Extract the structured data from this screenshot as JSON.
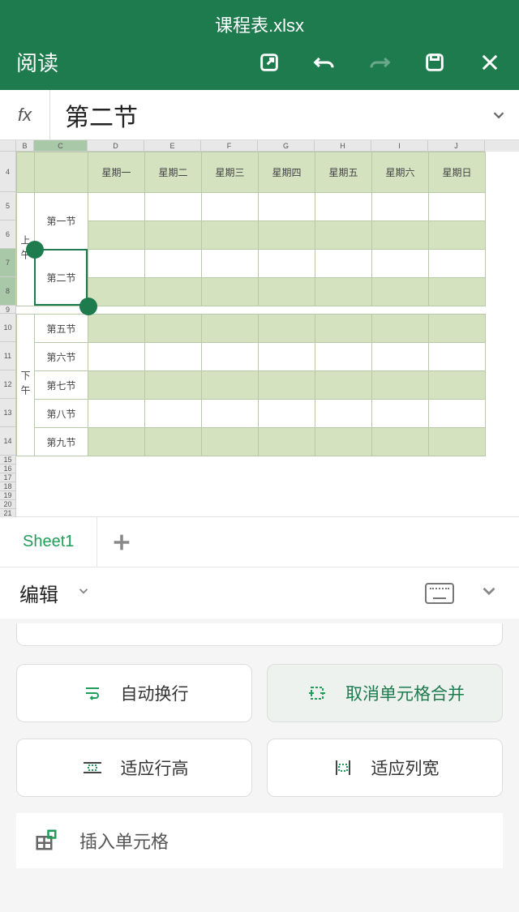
{
  "header": {
    "title": "课程表.xlsx",
    "read_mode": "阅读"
  },
  "formula_bar": {
    "fx": "fx",
    "value": "第二节"
  },
  "columns": [
    "B",
    "C",
    "D",
    "E",
    "F",
    "G",
    "H",
    "I",
    "J"
  ],
  "rows": [
    "4",
    "5",
    "6",
    "7",
    "8",
    "9",
    "10",
    "11",
    "12",
    "13",
    "14",
    "15",
    "16",
    "17",
    "18",
    "19",
    "20",
    "21"
  ],
  "days": [
    "星期一",
    "星期二",
    "星期三",
    "星期四",
    "星期五",
    "星期六",
    "星期日"
  ],
  "am_label": "上午",
  "pm_label": "下午",
  "periods_am": [
    "第一节",
    "第二节"
  ],
  "periods_pm": [
    "第五节",
    "第六节",
    "第七节",
    "第八节",
    "第九节"
  ],
  "sheet_tab": "Sheet1",
  "edit_bar": {
    "label": "编辑"
  },
  "buttons": {
    "wrap": "自动换行",
    "unmerge": "取消单元格合并",
    "fit_row": "适应行高",
    "fit_col": "适应列宽"
  },
  "insert_cells": "插入单元格"
}
